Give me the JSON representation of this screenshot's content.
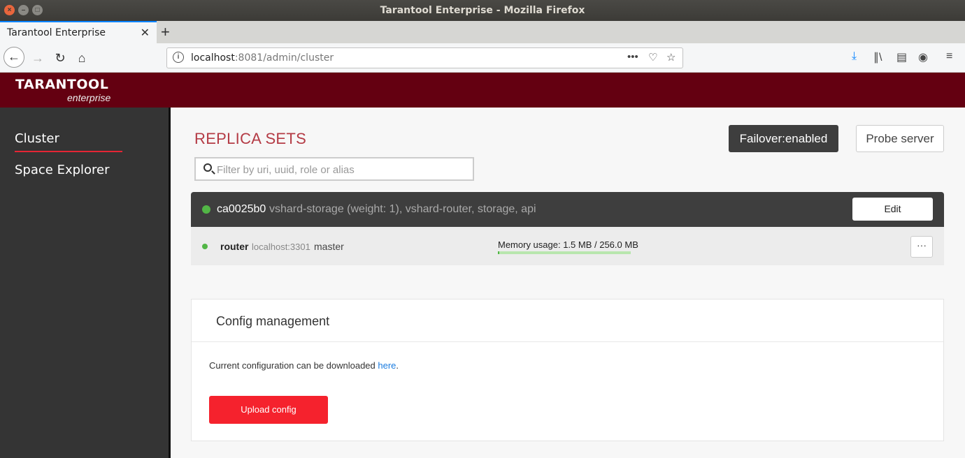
{
  "window": {
    "title": "Tarantool Enterprise - Mozilla Firefox"
  },
  "browser": {
    "tab_title": "Tarantool Enterprise",
    "url_host": "localhost",
    "url_rest": ":8081/admin/cluster"
  },
  "brand": {
    "name": "TARANTOOL",
    "sub": "enterprise"
  },
  "sidebar": {
    "items": [
      {
        "label": "Cluster",
        "active": true
      },
      {
        "label": "Space Explorer",
        "active": false
      }
    ]
  },
  "main": {
    "title": "REPLICA SETS",
    "failover_label": "Failover:enabled",
    "probe_label": "Probe server",
    "search_placeholder": "Filter by uri, uuid, role or alias",
    "replica_set": {
      "name": "ca0025b0",
      "roles": "vshard-storage (weight: 1), vshard-router, storage, api",
      "status_color": "#52b646",
      "edit_label": "Edit",
      "server": {
        "name": "router",
        "uri": "localhost:3301",
        "role": "master",
        "memory_label": "Memory usage: 1.5 MB / 256.0 MB",
        "memory_fraction": 0.006,
        "more_label": "···"
      }
    },
    "config": {
      "title": "Config management",
      "text": "Current configuration can be downloaded ",
      "link": "here",
      "text_end": ".",
      "upload_label": "Upload config"
    }
  },
  "colors": {
    "brand": "#640011",
    "accent": "#e52534",
    "title": "#b43b45",
    "upload": "#f5222d"
  }
}
